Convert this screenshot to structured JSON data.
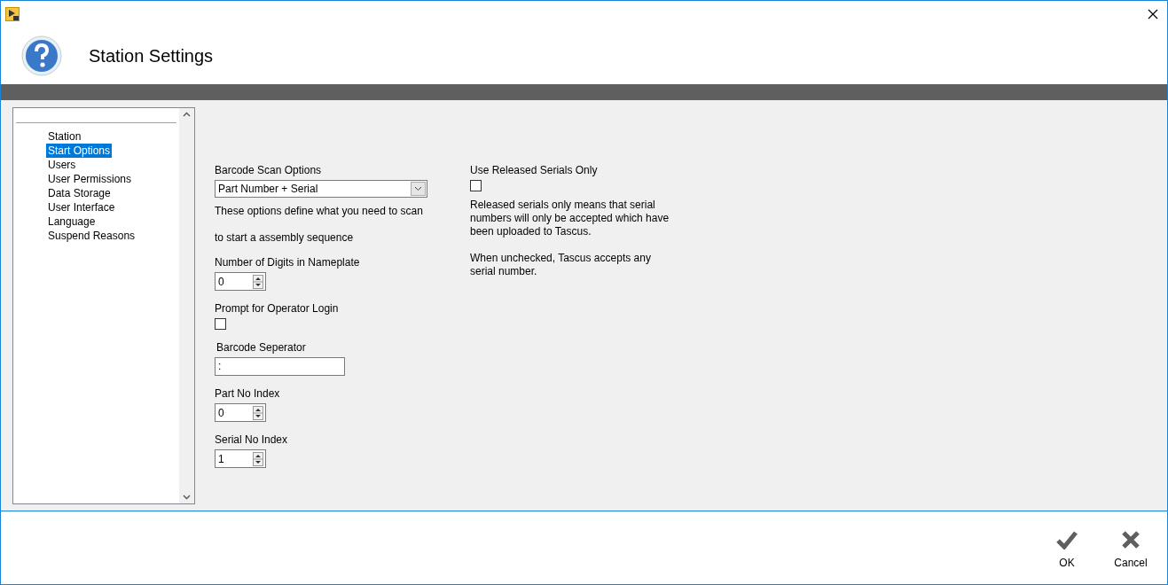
{
  "header": {
    "title": "Station Settings"
  },
  "sidebar": {
    "items": [
      {
        "label": "Station",
        "selected": false
      },
      {
        "label": "Start Options",
        "selected": true
      },
      {
        "label": "Users",
        "selected": false
      },
      {
        "label": "User Permissions",
        "selected": false
      },
      {
        "label": "Data Storage",
        "selected": false
      },
      {
        "label": "User Interface",
        "selected": false
      },
      {
        "label": "Language",
        "selected": false
      },
      {
        "label": "Suspend Reasons",
        "selected": false
      }
    ]
  },
  "left_fields": [
    {
      "kind": "dropdown",
      "label": "Barcode Scan Options",
      "value": "Part Number + Serial",
      "help": [
        "These options define what you need to scan",
        "to start a assembly sequence"
      ]
    },
    {
      "kind": "spinner",
      "label": "Number of Digits in Nameplate",
      "value": "0"
    },
    {
      "kind": "checkbox",
      "label": "Prompt for Operator Login",
      "checked": false
    },
    {
      "kind": "text",
      "label": "Barcode Seperator",
      "value": ":"
    },
    {
      "kind": "spinner",
      "label": "Part No Index",
      "value": "0"
    },
    {
      "kind": "spinner",
      "label": "Serial No Index",
      "value": "1"
    }
  ],
  "right_fields": [
    {
      "kind": "checkbox",
      "label": "Use Released Serials Only",
      "checked": false,
      "help": [
        "Released serials only means that serial numbers will only be accepted which have been uploaded to Tascus.",
        "When unchecked, Tascus accepts any serial number."
      ]
    }
  ],
  "buttons": [
    {
      "kind": "ok",
      "label": "OK"
    },
    {
      "kind": "cancel",
      "label": "Cancel"
    }
  ]
}
